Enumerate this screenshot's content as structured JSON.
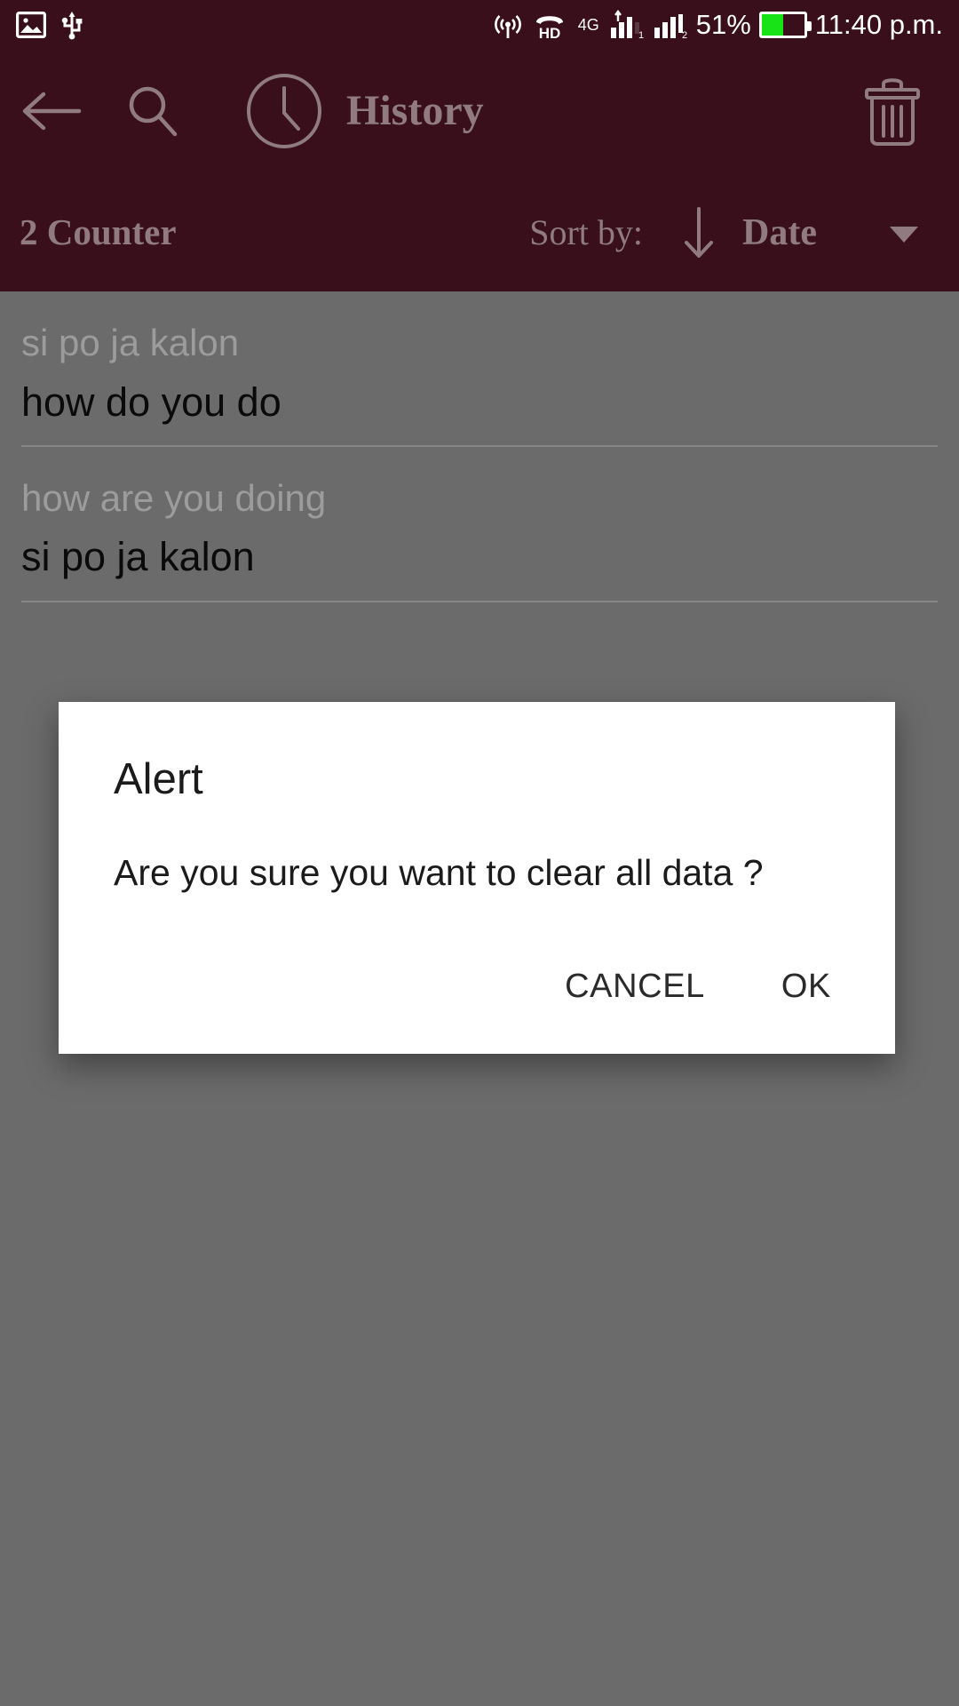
{
  "statusbar": {
    "icons_left": [
      "image-icon",
      "usb-icon"
    ],
    "hotspot": "hotspot-icon",
    "hd_label": "HD",
    "network_label": "4G",
    "signal1": "signal-bars-sim1-icon",
    "signal2": "signal-bars-sim2-icon",
    "battery_percent": "51%",
    "battery_level": 51,
    "battery_icon": "battery-icon",
    "time": "11:40 p.m."
  },
  "appbar": {
    "back_icon": "arrow-left-icon",
    "search_icon": "search-icon",
    "clock_icon": "clock-icon",
    "title": "History",
    "delete_icon": "trash-icon"
  },
  "sortbar": {
    "counter": "2 Counter",
    "sort_label": "Sort by:",
    "direction_icon": "arrow-down-icon",
    "sort_value": "Date",
    "caret_icon": "chevron-down-icon"
  },
  "history": {
    "items": [
      {
        "source": "si po ja kalon",
        "target": "how do you do"
      },
      {
        "source": "how are you doing",
        "target": "si po ja kalon"
      }
    ]
  },
  "dialog": {
    "title": "Alert",
    "message": "Are you sure you want to clear all data ?",
    "cancel_label": "CANCEL",
    "ok_label": "OK"
  },
  "colors": {
    "appbar_bg": "#3a0f1c",
    "appbar_fg": "#8f7b80",
    "content_bg": "#6b6b6b",
    "battery_green": "#17e317",
    "dialog_bg": "#ffffff"
  }
}
